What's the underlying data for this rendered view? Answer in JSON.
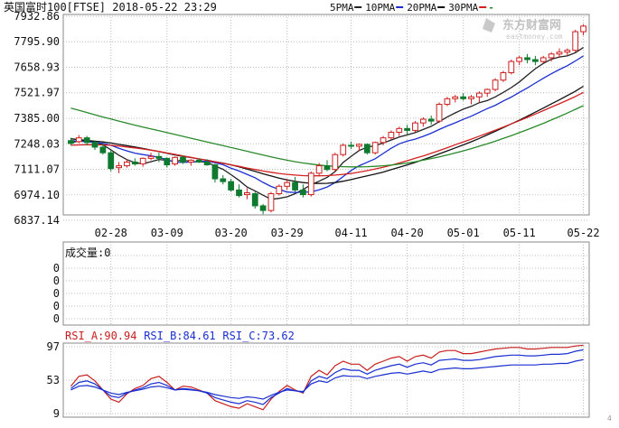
{
  "header": {
    "title": "英国富时100[FTSE] 2018-05-22 23:29",
    "ma_labels": [
      {
        "label": "5PMA",
        "color": "#222222"
      },
      {
        "label": "10PMA",
        "color": "#1a2fd0"
      },
      {
        "label": "20PMA",
        "color": "#111111"
      },
      {
        "label": "30PMA",
        "color": "#d42020"
      }
    ],
    "ma_extra_marker": "-",
    "ma_extra_color": "#2a8a2a"
  },
  "watermark": {
    "brand": "东方财富网",
    "sub": "eastmoney.com"
  },
  "colors": {
    "up": "#cc1e1e",
    "down": "#0f7a2f",
    "grid": "#bdbdbd",
    "frame": "#888888"
  },
  "chart_data": [
    {
      "type": "candlestick",
      "title": "英国富时100[FTSE]",
      "y_ticks": [
        "7932.86",
        "7795.90",
        "7658.93",
        "7521.97",
        "7385.00",
        "7248.03",
        "7111.07",
        "6974.10",
        "6837.14"
      ],
      "ylim": [
        6837.14,
        7932.86
      ],
      "x_ticks": [
        "02-28",
        "03-09",
        "03-20",
        "03-29",
        "04-11",
        "04-20",
        "05-01",
        "05-11",
        "05-22"
      ],
      "x_tick_index": [
        5,
        12,
        20,
        27,
        35,
        42,
        49,
        56,
        64
      ],
      "candles": [
        [
          7265,
          7280,
          7240,
          7250
        ],
        [
          7260,
          7295,
          7250,
          7280
        ],
        [
          7280,
          7290,
          7240,
          7255
        ],
        [
          7255,
          7265,
          7215,
          7230
        ],
        [
          7230,
          7250,
          7190,
          7200
        ],
        [
          7200,
          7215,
          7100,
          7115
        ],
        [
          7120,
          7150,
          7090,
          7130
        ],
        [
          7130,
          7165,
          7120,
          7150
        ],
        [
          7150,
          7170,
          7130,
          7140
        ],
        [
          7140,
          7175,
          7125,
          7170
        ],
        [
          7170,
          7200,
          7160,
          7180
        ],
        [
          7180,
          7200,
          7150,
          7170
        ],
        [
          7170,
          7175,
          7120,
          7135
        ],
        [
          7140,
          7180,
          7130,
          7175
        ],
        [
          7175,
          7185,
          7140,
          7150
        ],
        [
          7150,
          7165,
          7130,
          7160
        ],
        [
          7160,
          7170,
          7145,
          7150
        ],
        [
          7150,
          7165,
          7130,
          7135
        ],
        [
          7135,
          7140,
          7040,
          7060
        ],
        [
          7060,
          7080,
          7030,
          7045
        ],
        [
          7045,
          7060,
          6990,
          7000
        ],
        [
          7000,
          7030,
          6960,
          6970
        ],
        [
          6975,
          7010,
          6950,
          6985
        ],
        [
          6980,
          6990,
          6900,
          6915
        ],
        [
          6915,
          6925,
          6870,
          6890
        ],
        [
          6890,
          6990,
          6880,
          6980
        ],
        [
          6980,
          7030,
          6970,
          7020
        ],
        [
          7020,
          7060,
          7000,
          7040
        ],
        [
          7040,
          7070,
          6990,
          7000
        ],
        [
          7000,
          7030,
          6960,
          6975
        ],
        [
          6975,
          7100,
          6965,
          7090
        ],
        [
          7090,
          7145,
          7080,
          7130
        ],
        [
          7130,
          7160,
          7100,
          7110
        ],
        [
          7110,
          7200,
          7100,
          7190
        ],
        [
          7190,
          7250,
          7180,
          7240
        ],
        [
          7240,
          7260,
          7220,
          7235
        ],
        [
          7235,
          7250,
          7210,
          7245
        ],
        [
          7245,
          7250,
          7190,
          7200
        ],
        [
          7200,
          7260,
          7190,
          7255
        ],
        [
          7255,
          7290,
          7240,
          7280
        ],
        [
          7280,
          7320,
          7270,
          7310
        ],
        [
          7310,
          7340,
          7290,
          7330
        ],
        [
          7330,
          7350,
          7300,
          7320
        ],
        [
          7320,
          7370,
          7310,
          7360
        ],
        [
          7360,
          7390,
          7340,
          7380
        ],
        [
          7380,
          7400,
          7350,
          7370
        ],
        [
          7370,
          7470,
          7360,
          7460
        ],
        [
          7460,
          7500,
          7450,
          7490
        ],
        [
          7490,
          7510,
          7470,
          7500
        ],
        [
          7500,
          7520,
          7480,
          7490
        ],
        [
          7490,
          7510,
          7460,
          7500
        ],
        [
          7500,
          7530,
          7470,
          7520
        ],
        [
          7520,
          7545,
          7500,
          7540
        ],
        [
          7540,
          7600,
          7530,
          7590
        ],
        [
          7590,
          7640,
          7580,
          7630
        ],
        [
          7630,
          7700,
          7620,
          7690
        ],
        [
          7690,
          7720,
          7670,
          7710
        ],
        [
          7710,
          7730,
          7680,
          7700
        ],
        [
          7700,
          7720,
          7670,
          7690
        ],
        [
          7690,
          7720,
          7680,
          7710
        ],
        [
          7710,
          7740,
          7690,
          7730
        ],
        [
          7730,
          7760,
          7710,
          7740
        ],
        [
          7740,
          7760,
          7720,
          7750
        ],
        [
          7750,
          7860,
          7740,
          7850
        ],
        [
          7850,
          7890,
          7830,
          7880
        ]
      ],
      "ma_lines": [
        {
          "name": "5PMA",
          "color": "#222222",
          "values": [
            7255,
            7262,
            7266,
            7256,
            7243,
            7216,
            7186,
            7163,
            7147,
            7141,
            7152,
            7164,
            7159,
            7154,
            7162,
            7152,
            7152,
            7150,
            7129,
            7111,
            7082,
            7052,
            7016,
            6995,
            6972,
            6950,
            6955,
            6963,
            6980,
            7003,
            7028,
            7047,
            7068,
            7099,
            7148,
            7181,
            7212,
            7230,
            7238,
            7252,
            7268,
            7284,
            7296,
            7308,
            7325,
            7342,
            7367,
            7392,
            7414,
            7434,
            7449,
            7469,
            7480,
            7500,
            7524,
            7550,
            7580,
            7616,
            7651,
            7680,
            7702,
            7714,
            7720,
            7737,
            7765
          ]
        },
        {
          "name": "10PMA",
          "color": "#1a2fd0",
          "values": [
            7265,
            7262,
            7260,
            7255,
            7250,
            7240,
            7224,
            7210,
            7198,
            7190,
            7184,
            7175,
            7162,
            7150,
            7148,
            7150,
            7152,
            7155,
            7146,
            7136,
            7117,
            7102,
            7084,
            7066,
            7041,
            7019,
            7004,
            6989,
            6987,
            6988,
            6990,
            7001,
            7016,
            7040,
            7072,
            7105,
            7130,
            7149,
            7168,
            7196,
            7224,
            7248,
            7263,
            7273,
            7288,
            7305,
            7325,
            7344,
            7361,
            7379,
            7396,
            7417,
            7437,
            7455,
            7478,
            7499,
            7524,
            7548,
            7574,
            7600,
            7624,
            7647,
            7667,
            7693,
            7720
          ]
        },
        {
          "name": "20PMA",
          "color": "#111111",
          "values": [
            7275,
            7270,
            7266,
            7262,
            7258,
            7252,
            7245,
            7238,
            7231,
            7223,
            7215,
            7206,
            7197,
            7188,
            7181,
            7174,
            7167,
            7160,
            7152,
            7144,
            7135,
            7124,
            7112,
            7100,
            7087,
            7075,
            7064,
            7054,
            7046,
            7040,
            7036,
            7035,
            7036,
            7040,
            7047,
            7056,
            7066,
            7076,
            7086,
            7096,
            7109,
            7122,
            7135,
            7148,
            7163,
            7178,
            7194,
            7210,
            7226,
            7242,
            7259,
            7277,
            7296,
            7315,
            7335,
            7355,
            7375,
            7396,
            7418,
            7440,
            7462,
            7484,
            7507,
            7530,
            7557
          ]
        },
        {
          "name": "30PMA",
          "color": "#d42020",
          "values": [
            7240,
            7242,
            7243,
            7243,
            7242,
            7240,
            7236,
            7231,
            7226,
            7220,
            7214,
            7207,
            7199,
            7191,
            7183,
            7175,
            7167,
            7159,
            7151,
            7143,
            7135,
            7127,
            7118,
            7110,
            7102,
            7095,
            7089,
            7084,
            7080,
            7077,
            7076,
            7076,
            7077,
            7080,
            7084,
            7089,
            7096,
            7104,
            7113,
            7122,
            7133,
            7145,
            7157,
            7170,
            7183,
            7197,
            7212,
            7227,
            7243,
            7258,
            7273,
            7289,
            7305,
            7321,
            7338,
            7355,
            7372,
            7390,
            7408,
            7426,
            7445,
            7463,
            7482,
            7502,
            7524
          ]
        },
        {
          "name": "",
          "color": "#2a8a2a",
          "values": [
            7440,
            7428,
            7416,
            7404,
            7392,
            7381,
            7370,
            7359,
            7348,
            7338,
            7328,
            7318,
            7308,
            7298,
            7288,
            7278,
            7268,
            7258,
            7248,
            7238,
            7228,
            7218,
            7208,
            7198,
            7188,
            7178,
            7169,
            7160,
            7152,
            7145,
            7139,
            7134,
            7130,
            7127,
            7125,
            7124,
            7124,
            7125,
            7127,
            7130,
            7134,
            7139,
            7145,
            7152,
            7160,
            7169,
            7178,
            7188,
            7199,
            7210,
            7222,
            7235,
            7248,
            7262,
            7277,
            7292,
            7308,
            7324,
            7341,
            7358,
            7376,
            7394,
            7413,
            7433,
            7453
          ]
        }
      ]
    },
    {
      "type": "bar",
      "title": "成交量:0",
      "y_ticks": [
        "0",
        "0",
        "0",
        "0",
        "0"
      ],
      "values": []
    },
    {
      "type": "line",
      "title": "RSI",
      "labels": [
        {
          "text": "RSI_A:90.94",
          "color": "#c81e1e"
        },
        {
          "text": "RSI_B:84.61",
          "color": "#1a2fd0"
        },
        {
          "text": "RSI_C:73.62",
          "color": "#1a2fd0"
        }
      ],
      "y_ticks": [
        "97",
        "53",
        "9"
      ],
      "ylim": [
        9,
        97
      ],
      "series": [
        {
          "name": "RSI_A",
          "color": "#c81e1e",
          "values": [
            45,
            58,
            60,
            52,
            40,
            28,
            24,
            35,
            42,
            46,
            55,
            58,
            50,
            40,
            45,
            44,
            40,
            36,
            26,
            22,
            18,
            16,
            22,
            18,
            14,
            28,
            38,
            46,
            40,
            36,
            58,
            66,
            60,
            72,
            78,
            74,
            74,
            66,
            74,
            78,
            82,
            84,
            78,
            84,
            86,
            82,
            90,
            92,
            92,
            88,
            88,
            90,
            92,
            94,
            95,
            96,
            96,
            94,
            94,
            95,
            96,
            96,
            96,
            98,
            99
          ]
        },
        {
          "name": "RSI_B",
          "color": "#1a2fd0",
          "values": [
            42,
            50,
            52,
            48,
            40,
            32,
            30,
            36,
            40,
            43,
            48,
            50,
            46,
            40,
            42,
            41,
            39,
            36,
            30,
            27,
            24,
            22,
            26,
            24,
            21,
            30,
            36,
            42,
            39,
            37,
            52,
            58,
            55,
            63,
            68,
            66,
            66,
            61,
            66,
            69,
            72,
            74,
            70,
            74,
            76,
            73,
            79,
            80,
            81,
            79,
            79,
            80,
            82,
            84,
            85,
            86,
            86,
            85,
            85,
            86,
            87,
            87,
            88,
            91,
            93
          ]
        },
        {
          "name": "RSI_C",
          "color": "#1a2fd0",
          "values": [
            40,
            45,
            46,
            44,
            40,
            36,
            34,
            37,
            39,
            41,
            44,
            45,
            43,
            40,
            41,
            40,
            39,
            37,
            34,
            32,
            30,
            29,
            31,
            30,
            28,
            33,
            37,
            40,
            39,
            38,
            48,
            52,
            50,
            56,
            59,
            58,
            58,
            55,
            58,
            60,
            62,
            63,
            61,
            63,
            65,
            63,
            67,
            68,
            69,
            68,
            68,
            69,
            70,
            71,
            72,
            73,
            73,
            73,
            73,
            74,
            74,
            75,
            75,
            78,
            80
          ]
        }
      ]
    }
  ],
  "footer": {
    "corner_mark": "4"
  }
}
